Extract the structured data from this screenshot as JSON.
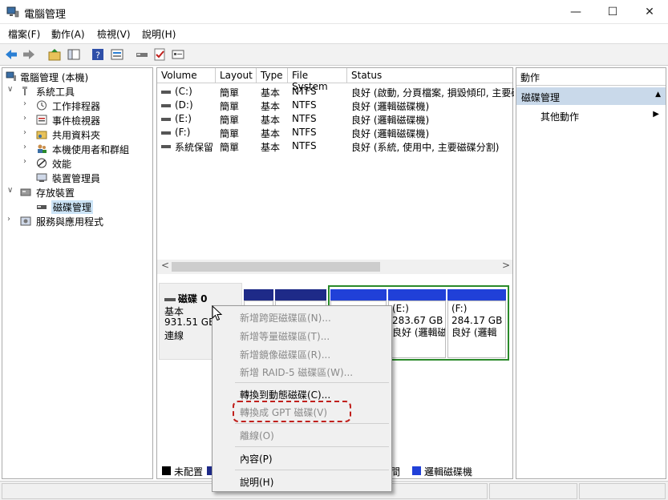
{
  "window": {
    "title": "電腦管理",
    "min_glyph": "—",
    "max_glyph": "☐",
    "close_glyph": "✕"
  },
  "menu": [
    "檔案(F)",
    "動作(A)",
    "檢視(V)",
    "說明(H)"
  ],
  "tree": {
    "root": "電腦管理 (本機)",
    "system_tools": "系統工具",
    "task_scheduler": "工作排程器",
    "event_viewer": "事件檢視器",
    "shared_folders": "共用資料夾",
    "local_users": "本機使用者和群組",
    "performance": "效能",
    "device_manager": "裝置管理員",
    "storage": "存放裝置",
    "disk_management": "磁碟管理",
    "services": "服務與應用程式"
  },
  "columns": [
    "Volume",
    "Layout",
    "Type",
    "File System",
    "Status"
  ],
  "volumes": [
    {
      "name": "(C:)",
      "layout": "簡單",
      "type": "基本",
      "fs": "NTFS",
      "status": "良好 (啟動, 分頁檔案, 損毀傾印, 主要磁"
    },
    {
      "name": "(D:)",
      "layout": "簡單",
      "type": "基本",
      "fs": "NTFS",
      "status": "良好 (邏輯磁碟機)"
    },
    {
      "name": "(E:)",
      "layout": "簡單",
      "type": "基本",
      "fs": "NTFS",
      "status": "良好 (邏輯磁碟機)"
    },
    {
      "name": "(F:)",
      "layout": "簡單",
      "type": "基本",
      "fs": "NTFS",
      "status": "良好 (邏輯磁碟機)"
    },
    {
      "name": "系統保留",
      "layout": "簡單",
      "type": "基本",
      "fs": "NTFS",
      "status": "良好 (系統, 使用中, 主要磁碟分割)"
    }
  ],
  "scroll": {
    "left": "<",
    "right": ">"
  },
  "disk": {
    "name": "磁碟 0",
    "type": "基本",
    "size": "931.51 GB",
    "state": "連線",
    "partitions": [
      {
        "label": "(E:)",
        "size": "283.67 GB",
        "status": "良好 (邏輯磁"
      },
      {
        "label": "(F:)",
        "size": "284.17 GB",
        "status": "良好 (邏輯"
      }
    ]
  },
  "legend": {
    "unallocated": "未配置",
    "free_space_tail": "空間",
    "logical": "邏輯磁碟機"
  },
  "actions": {
    "header": "動作",
    "section": "磁碟管理",
    "more": "其他動作"
  },
  "context_menu": {
    "span": "新增跨距磁碟區(N)...",
    "stripe": "新增等量磁碟區(T)...",
    "mirror": "新增鏡像磁碟區(R)...",
    "raid5": "新增 RAID-5 磁碟區(W)...",
    "dynamic": "轉換到動態磁碟(C)...",
    "gpt": "轉換成 GPT 磁碟(V)",
    "offline": "離線(O)",
    "properties": "內容(P)",
    "help": "說明(H)"
  },
  "colors": {
    "primary_partition": "#1e2a88",
    "logical_drive": "#2040d8",
    "extended_border": "#2a8a2a",
    "highlight": "#c0201c"
  }
}
